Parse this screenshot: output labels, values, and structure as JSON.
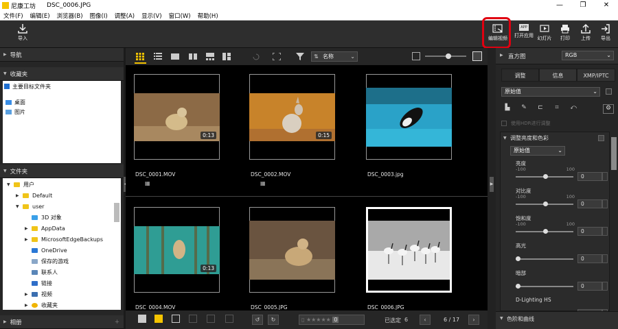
{
  "window": {
    "app_name": "尼康工坊",
    "file_name": "DSC_0006.JPG",
    "controls": [
      "—",
      "❐",
      "✕"
    ]
  },
  "menu": [
    "文件(F)",
    "编辑(E)",
    "浏览器(B)",
    "图像(I)",
    "调整(A)",
    "显示(V)",
    "窗口(W)",
    "帮助(H)"
  ],
  "toolbar": {
    "import_label": "导入",
    "edit_label": "编辑视频",
    "app_badge": "APP",
    "slideshow_label": "幻灯片",
    "print_label": "打印",
    "upload_label": "上传",
    "export_label": "导出",
    "openapp_label": "打开应用"
  },
  "left": {
    "navigation": "导航",
    "favorites": "收藏夹",
    "favorites_root": "主要目标文件夹",
    "favorites_items": [
      "桌面",
      "图片"
    ],
    "folders": "文件夹",
    "tree": [
      {
        "label": "用户",
        "depth": 0,
        "arrow": "▼",
        "type": "folder"
      },
      {
        "label": "Default",
        "depth": 1,
        "arrow": "▶",
        "type": "folder"
      },
      {
        "label": "user",
        "depth": 1,
        "arrow": "▼",
        "type": "folder"
      },
      {
        "label": "3D 对象",
        "depth": 2,
        "arrow": "",
        "type": "3d"
      },
      {
        "label": "AppData",
        "depth": 2,
        "arrow": "▶",
        "type": "folder"
      },
      {
        "label": "MicrosoftEdgeBackups",
        "depth": 2,
        "arrow": "▶",
        "type": "folder"
      },
      {
        "label": "OneDrive",
        "depth": 2,
        "arrow": "",
        "type": "cloud"
      },
      {
        "label": "保存的游戏",
        "depth": 2,
        "arrow": "",
        "type": "game"
      },
      {
        "label": "联系人",
        "depth": 2,
        "arrow": "",
        "type": "contact"
      },
      {
        "label": "链接",
        "depth": 2,
        "arrow": "",
        "type": "link"
      },
      {
        "label": "视频",
        "depth": 2,
        "arrow": "▶",
        "type": "video"
      },
      {
        "label": "收藏夹",
        "depth": 2,
        "arrow": "▶",
        "type": "star"
      }
    ],
    "album": "相册"
  },
  "center": {
    "sort_label": "名称",
    "thumbnails": [
      {
        "name": "DSC_0001.MOV",
        "duration": "0:13",
        "movie": true,
        "scene": "prairie"
      },
      {
        "name": "DSC_0002.MOV",
        "duration": "0:15",
        "movie": true,
        "scene": "wallaby"
      },
      {
        "name": "DSC_0003.jpg",
        "duration": "",
        "movie": false,
        "scene": "orca"
      },
      {
        "name": "DSC_0004.MOV",
        "duration": "0:13",
        "movie": true,
        "scene": "seahorse"
      },
      {
        "name": "DSC_0005.JPG",
        "duration": "",
        "movie": false,
        "scene": "prairie2"
      },
      {
        "name": "DSC_0006.JPG",
        "duration": "",
        "movie": false,
        "scene": "cranes"
      }
    ],
    "selected_label": "已选定",
    "selected_count": "6",
    "page_info": "6 / 17",
    "rating_count": "0"
  },
  "right": {
    "histogram": "直方图",
    "histogram_mode": "RGB",
    "tabs": [
      "调整",
      "信息",
      "XMP/IPTC"
    ],
    "preset": "原始值",
    "hdr_label": "使用HDR进行调整",
    "section_brightness": "调整亮度和色彩",
    "section_preset": "原始值",
    "sliders": [
      {
        "label": "亮度",
        "min": "-100",
        "max": "100",
        "value": "0",
        "position": 0.5
      },
      {
        "label": "对比度",
        "min": "-100",
        "max": "100",
        "value": "0",
        "position": 0.5
      },
      {
        "label": "饱和度",
        "min": "-100",
        "max": "100",
        "value": "0",
        "position": 0.5
      },
      {
        "label": "高光",
        "min": "",
        "max": "",
        "value": "0",
        "position": 0.0
      },
      {
        "label": "暗部",
        "min": "",
        "max": "",
        "value": "0",
        "position": 0.0
      },
      {
        "label": "D-Lighting HS",
        "min": "",
        "max": "",
        "value": "0",
        "position": 0.0
      }
    ],
    "section_levels": "色阶和曲线"
  },
  "colors": {
    "accent": "#f5c400",
    "highlight": "#e00010",
    "selected_border": "#ffffff"
  }
}
